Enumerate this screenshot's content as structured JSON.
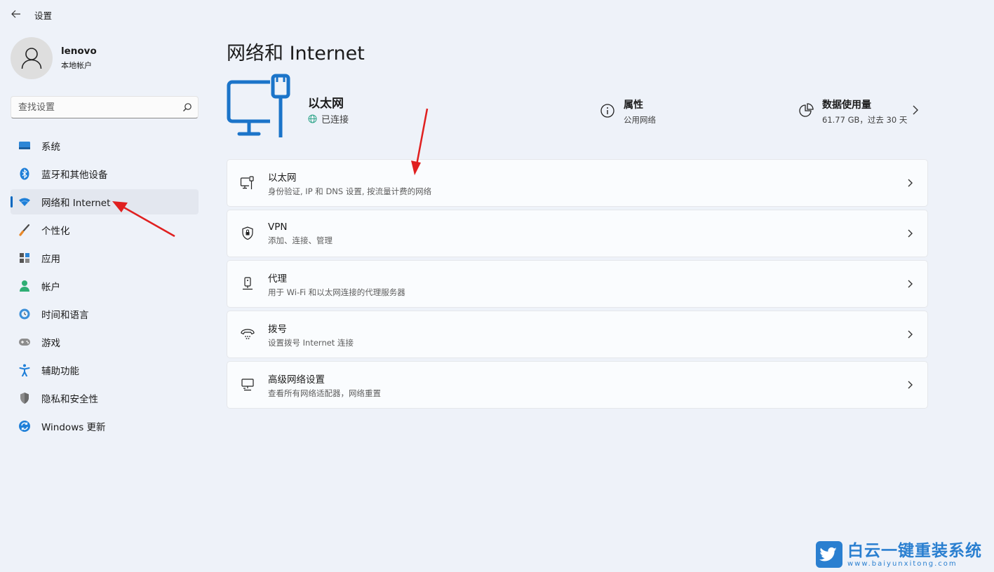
{
  "window": {
    "title": "设置"
  },
  "profile": {
    "name": "lenovo",
    "account_type": "本地帐户"
  },
  "search": {
    "placeholder": "查找设置"
  },
  "sidebar": {
    "items": [
      {
        "label": "系统",
        "icon": "system-icon",
        "active": false
      },
      {
        "label": "蓝牙和其他设备",
        "icon": "bluetooth-icon",
        "active": false
      },
      {
        "label": "网络和 Internet",
        "icon": "wifi-icon",
        "active": true
      },
      {
        "label": "个性化",
        "icon": "brush-icon",
        "active": false
      },
      {
        "label": "应用",
        "icon": "apps-icon",
        "active": false
      },
      {
        "label": "帐户",
        "icon": "account-icon",
        "active": false
      },
      {
        "label": "时间和语言",
        "icon": "time-language-icon",
        "active": false
      },
      {
        "label": "游戏",
        "icon": "gamepad-icon",
        "active": false
      },
      {
        "label": "辅助功能",
        "icon": "accessibility-icon",
        "active": false
      },
      {
        "label": "隐私和安全性",
        "icon": "shield-icon",
        "active": false
      },
      {
        "label": "Windows 更新",
        "icon": "update-icon",
        "active": false
      }
    ]
  },
  "main": {
    "title": "网络和 Internet",
    "hero": {
      "name": "以太网",
      "status": "已连接",
      "properties": {
        "title": "属性",
        "subtitle": "公用网络"
      },
      "data_usage": {
        "title": "数据使用量",
        "subtitle": "61.77 GB，过去 30 天"
      }
    },
    "cards": [
      {
        "title": "以太网",
        "subtitle": "身份验证, IP 和 DNS 设置, 按流量计费的网络",
        "icon": "ethernet-icon"
      },
      {
        "title": "VPN",
        "subtitle": "添加、连接、管理",
        "icon": "vpn-shield-icon"
      },
      {
        "title": "代理",
        "subtitle": "用于 Wi-Fi 和以太网连接的代理服务器",
        "icon": "proxy-icon"
      },
      {
        "title": "拨号",
        "subtitle": "设置拨号 Internet 连接",
        "icon": "dialup-icon"
      },
      {
        "title": "高级网络设置",
        "subtitle": "查看所有网络适配器，网络重置",
        "icon": "advanced-network-icon"
      }
    ]
  },
  "watermark": {
    "text": "白云一键重装系统",
    "url": "www.baiyunxitong.com"
  },
  "colors": {
    "accent": "#0067c0",
    "background": "#eef2f9",
    "annotation": "#e02020",
    "watermark": "#2a7fd0"
  }
}
